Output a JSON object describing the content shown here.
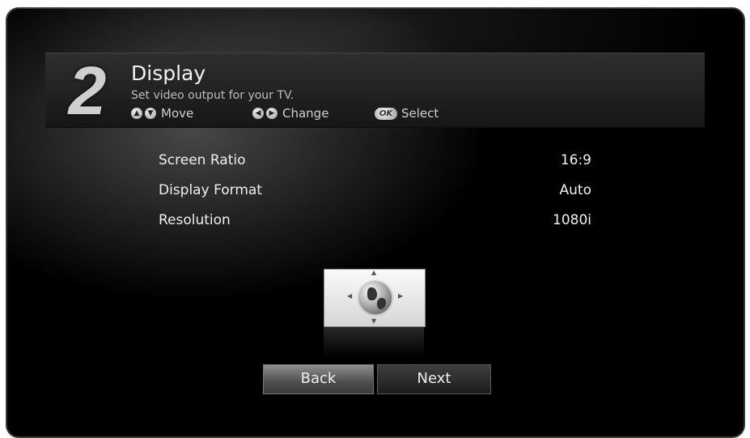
{
  "wizard": {
    "step_number": "2",
    "title": "Display",
    "subtitle": "Set video output for your TV.",
    "hints": {
      "move_label": "Move",
      "change_label": "Change",
      "select_label": "Select",
      "ok_key": "OK"
    }
  },
  "settings": [
    {
      "label": "Screen Ratio",
      "value": "16:9"
    },
    {
      "label": "Display Format",
      "value": "Auto"
    },
    {
      "label": "Resolution",
      "value": "1080i"
    }
  ],
  "buttons": {
    "back_label": "Back",
    "next_label": "Next"
  },
  "icons": {
    "preview": "globe-icon",
    "move": "up-down-arrow-icons",
    "change": "left-right-arrow-icons"
  }
}
